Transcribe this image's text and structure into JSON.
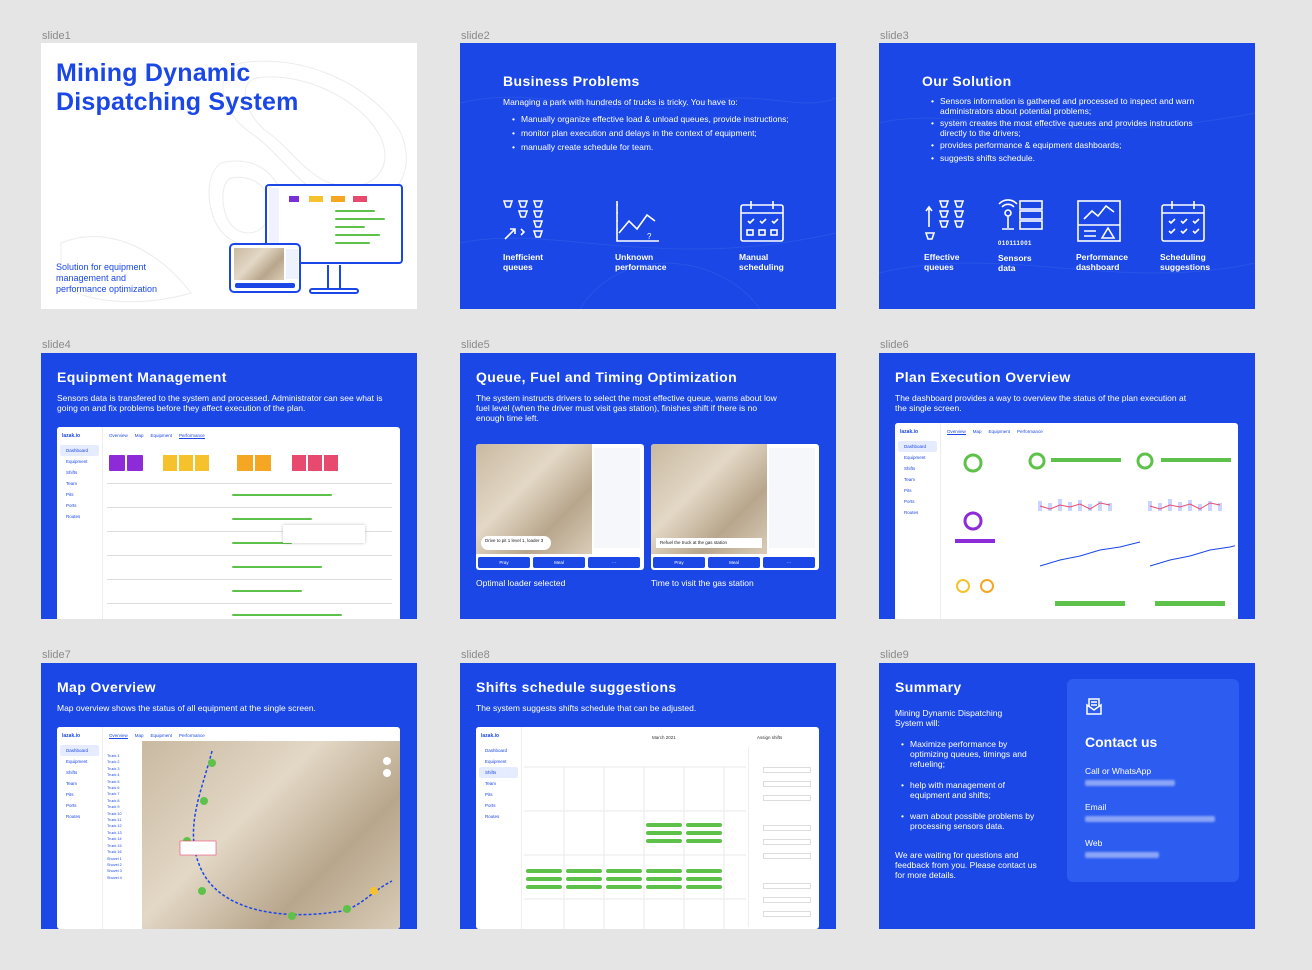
{
  "slides": [
    {
      "label": "slide1",
      "title_line1": "Mining Dynamic",
      "title_line2": "Dispatching System",
      "subtitle": [
        "Solution for equipment",
        "management and",
        "performance optimization"
      ]
    },
    {
      "label": "slide2",
      "title": "Business Problems",
      "intro": "Managing a park with hundreds of trucks is tricky. You have to:",
      "bullets": [
        "Manually organize effective load & unload queues, provide instructions;",
        "monitor plan execution and delays in the context of equipment;",
        "manually create schedule for team."
      ],
      "icons": [
        {
          "cap1": "Inefficient",
          "cap2": "queues",
          "icon": "queue-icon"
        },
        {
          "cap1": "Unknown",
          "cap2": "performance",
          "icon": "chart-icon"
        },
        {
          "cap1": "Manual",
          "cap2": "scheduling",
          "icon": "calendar-icon"
        }
      ]
    },
    {
      "label": "slide3",
      "title": "Our Solution",
      "bullets": [
        "Sensors information is gathered and processed to inspect and warn administrators about potential problems;",
        "system creates the most effective queues and provides instructions directly to the drivers;",
        "provides performance & equipment dashboards;",
        "suggests shifts schedule."
      ],
      "icons": [
        {
          "cap1": "Effective",
          "cap2": "queues",
          "icon": "queue-icon"
        },
        {
          "cap1": "Sensors",
          "cap2": "data",
          "icon": "sensor-icon",
          "code": "010111001"
        },
        {
          "cap1": "Performance",
          "cap2": "dashboard",
          "icon": "dashboard-icon"
        },
        {
          "cap1": "Scheduling",
          "cap2": "suggestions",
          "icon": "calendar-check-icon"
        }
      ]
    },
    {
      "label": "slide4",
      "title": "Equipment Management",
      "intro": "Sensors data is transfered to the system and processed. Administrator can see what is going on and fix problems before they affect execution of the plan."
    },
    {
      "label": "slide5",
      "title": "Queue, Fuel and Timing Optimization",
      "intro": "The system instructs drivers to select the most effective queue, warns about low fuel level (when the driver must visit gas station), finishes shift if there is no enough time left.",
      "cap_left": "Optimal loader selected",
      "cap_right": "Time to visit the gas station"
    },
    {
      "label": "slide6",
      "title": "Plan Execution Overview",
      "intro": "The dashboard provides a way to overview the status of the plan execution at the single screen."
    },
    {
      "label": "slide7",
      "title": "Map Overview",
      "intro": "Map overview shows the status of all equipment at the single screen."
    },
    {
      "label": "slide8",
      "title": "Shifts schedule suggestions",
      "intro": "The system suggests shifts schedule that can be adjusted."
    },
    {
      "label": "slide9",
      "title": "Summary",
      "intro": "Mining Dynamic Dispatching System will:",
      "bullets": [
        "Maximize performance by optimizing queues, timings and refueling;",
        "help with management of equipment and shifts;",
        "warn about possible problems by processing sensors data."
      ],
      "outro": "We are waiting for questions and feedback from you. Please contact us for more details.",
      "contact_title": "Contact us",
      "contact_items": [
        "Call or WhatsApp",
        "Email",
        "Web"
      ]
    }
  ],
  "mock": {
    "logo": "lazak.io",
    "tabs": [
      "Overview",
      "Map",
      "Equipment",
      "Performance"
    ],
    "sidebar": [
      "Dashboard",
      "Equipment",
      "Shifts",
      "Team",
      "Pits",
      "Ports",
      "Routes"
    ],
    "map_sidebar": [
      "Truck 1",
      "Truck 2",
      "Truck 3",
      "Truck 4",
      "Truck 5",
      "Truck 6",
      "Truck 7",
      "Truck 8",
      "Truck 9",
      "Truck 10",
      "Truck 11",
      "Truck 12",
      "Truck 13",
      "Truck 14",
      "Truck 15",
      "Truck 16",
      "Shovel 1",
      "Shovel 2",
      "Shovel 3",
      "Shovel 4"
    ],
    "calendar_month": "March 2021",
    "assign": "Assign shifts",
    "phone_left": "Drive to pit 1 level 1, loader 3",
    "phone_right": "Refuel the truck at the gas station",
    "btn_pray": "Pray",
    "btn_meal": "Meal"
  },
  "colors": {
    "brand": "#1a47e6",
    "contact_card": "#2d5cf0",
    "bg": "#e5e5e5"
  }
}
